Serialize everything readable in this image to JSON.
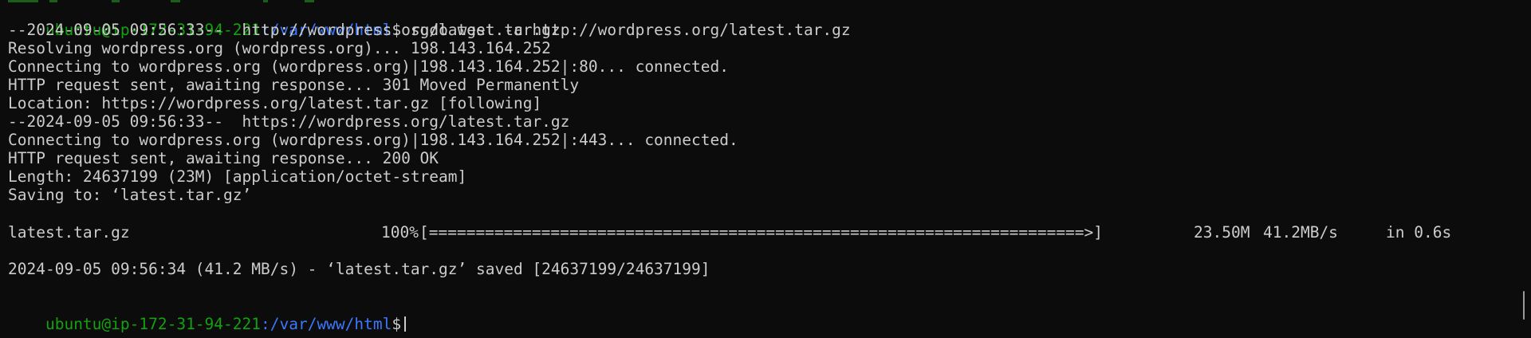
{
  "prompt": {
    "user_host": "ubuntu@ip-172-31-94-221",
    "path": ":/var/www/html",
    "symbol": "$"
  },
  "command": " sudo wget -c http://wordpress.org/latest.tar.gz",
  "output": [
    "--2024-09-05 09:56:33--  http://wordpress.org/latest.tar.gz",
    "Resolving wordpress.org (wordpress.org)... 198.143.164.252",
    "Connecting to wordpress.org (wordpress.org)|198.143.164.252|:80... connected.",
    "HTTP request sent, awaiting response... 301 Moved Permanently",
    "Location: https://wordpress.org/latest.tar.gz [following]",
    "--2024-09-05 09:56:33--  https://wordpress.org/latest.tar.gz",
    "Connecting to wordpress.org (wordpress.org)|198.143.164.252|:443... connected.",
    "HTTP request sent, awaiting response... 200 OK",
    "Length: 24637199 (23M) [application/octet-stream]",
    "Saving to: ‘latest.tar.gz’"
  ],
  "progress": {
    "filename": "latest.tar.gz",
    "percent": "100%",
    "bar": "[======================================================================>]",
    "size": "23.50M",
    "speed": "41.2MB/s",
    "time": "in 0.6s",
    "fraction": 1.0
  },
  "saved_line": "2024-09-05 09:56:34 (41.2 MB/s) - ‘latest.tar.gz’ saved [24637199/24637199]",
  "colors": {
    "background": "#0c0c0c",
    "text": "#cccccc",
    "prompt_user": "#13a10e",
    "prompt_path": "#3b78ff"
  }
}
